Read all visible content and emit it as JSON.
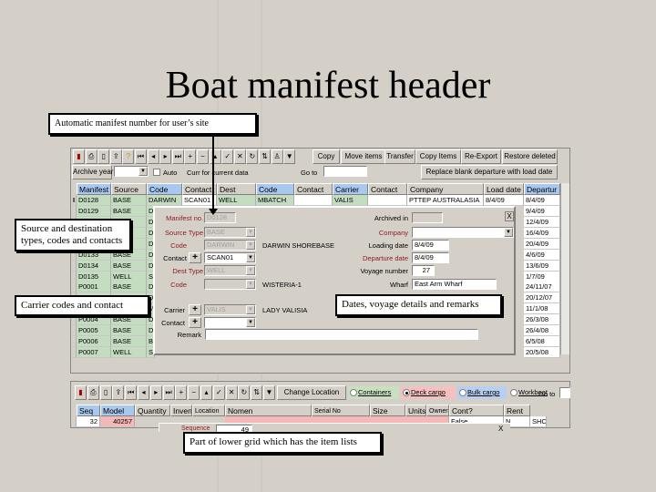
{
  "slide": {
    "title": "Boat manifest header"
  },
  "callouts": {
    "manifest_number": "Automatic manifest number for user’s site",
    "source_dest": "Source and destination types, codes and contacts",
    "carrier": "Carrier codes and contact",
    "dates": "Dates, voyage details and remarks",
    "lower_grid": "Part of lower grid which has the item lists"
  },
  "colors": {
    "header_blue": "#a8c8f0",
    "grid_green": "#c4dcc0",
    "pink": "#f4b8b8"
  },
  "toolbar": {
    "icons": [
      "exit-icon",
      "print-icon",
      "preview-icon",
      "export-icon",
      "help-icon",
      "first-icon",
      "prev-icon",
      "next-icon",
      "last-icon",
      "add-icon",
      "delete-icon",
      "edit-icon",
      "post-icon",
      "cancel-icon",
      "refresh-icon",
      "sort-icon",
      "filter-icon",
      "filter2-icon"
    ],
    "buttons": [
      "Copy",
      "Move items",
      "Transfer",
      "Copy Items",
      "Re-Export",
      "Restore deleted"
    ],
    "archive_year_label": "Archive year",
    "auto_label": "Auto",
    "curr_label": "Curr for current data",
    "goto_label": "Go to",
    "replace_button": "Replace blank departure with load date"
  },
  "grid": {
    "columns": [
      "Manifest",
      "Source",
      "Code",
      "Contact",
      "Dest",
      "Code",
      "Contact",
      "Carrier",
      "Contact",
      "Company",
      "Load date",
      "Departur"
    ],
    "first_row": [
      "D0128",
      "BASE",
      "DARWIN",
      "SCAN01",
      "WELL",
      "MBATCH",
      "",
      "VALIS",
      "",
      "PTTEP AUSTRALASIA",
      "8/4/09",
      "8/4/09"
    ],
    "rows": [
      {
        "manifest": "D0129",
        "source": "BASE",
        "code": "D",
        "departure": "9/4/09"
      },
      {
        "manifest": "",
        "source": "",
        "code": "D",
        "departure": "12/4/09"
      },
      {
        "manifest": "",
        "source": "",
        "code": "D",
        "departure": "16/4/09"
      },
      {
        "manifest": "",
        "source": "",
        "code": "D",
        "departure": "20/4/09"
      },
      {
        "manifest": "D0133",
        "source": "BASE",
        "code": "D",
        "departure": "4/6/09"
      },
      {
        "manifest": "D0134",
        "source": "BASE",
        "code": "D",
        "departure": "13/6/09"
      },
      {
        "manifest": "D0135",
        "source": "WELL",
        "code": "S",
        "departure": "1/7/09"
      },
      {
        "manifest": "P0001",
        "source": "BASE",
        "code": "D",
        "departure": "24/11/07"
      },
      {
        "manifest": "",
        "source": "",
        "code": "D",
        "departure": "20/12/07"
      },
      {
        "manifest": "",
        "source": "",
        "code": "M",
        "departure": "11/1/08"
      },
      {
        "manifest": "P0004",
        "source": "BASE",
        "code": "D",
        "departure": "26/3/08"
      },
      {
        "manifest": "P0005",
        "source": "BASE",
        "code": "D",
        "departure": "26/4/08"
      },
      {
        "manifest": "P0006",
        "source": "BASE",
        "code": "B",
        "departure": "6/5/08"
      },
      {
        "manifest": "P0007",
        "source": "WELL",
        "code": "S",
        "departure": "20/5/08"
      }
    ]
  },
  "dialog": {
    "manifest_no_label": "Manifest no.",
    "manifest_no": "D0128",
    "source_type_label": "Source Type",
    "source_type": "BASE",
    "code_label": "Code",
    "code": "DARWIN",
    "code_name": "DARWIN SHOREBASE",
    "contact_label": "Contact",
    "contact": "SCAN01",
    "dest_type_label": "Dest Type",
    "dest_type": "WELL",
    "dest_code_label": "Code",
    "dest_code": "",
    "dest_name": "WISTERIA-1",
    "carrier_label": "Carrier",
    "carrier": "VALIS",
    "carrier_name": "LADY VALISIA",
    "carrier_contact_label": "Contact",
    "carrier_contact": "",
    "remark_label": "Remark",
    "remark": "",
    "archived_label": "Archived in",
    "archived": "",
    "company_label": "Company",
    "company": "",
    "loading_label": "Loading date",
    "loading": "8/4/09",
    "departure_label": "Departure date",
    "departure": "8/4/09",
    "voyage_label": "Voyage number",
    "voyage": "27",
    "wharf_label": "Wharf",
    "wharf": "East Arm Wharf",
    "close": "X"
  },
  "lower": {
    "change_location": "Change Location",
    "radios": [
      {
        "label": "Containers",
        "checked": false
      },
      {
        "label": "Deck cargo",
        "checked": true
      },
      {
        "label": "Bulk cargo",
        "checked": false
      },
      {
        "label": "Workboat",
        "checked": false
      }
    ],
    "goto_label": "Go to",
    "columns": [
      "Seq",
      "Model",
      "Quantity",
      "Invent",
      "Location",
      "Nomen",
      "Serial No",
      "Size",
      "Units",
      "Owner",
      "Cont?",
      "Rent"
    ],
    "row": {
      "seq": "32",
      "model": "40257",
      "cont": "False",
      "rent": "N",
      "extra": "SHC"
    },
    "popup_label": "Sequence",
    "popup_value": "49",
    "popup_close": "X"
  }
}
